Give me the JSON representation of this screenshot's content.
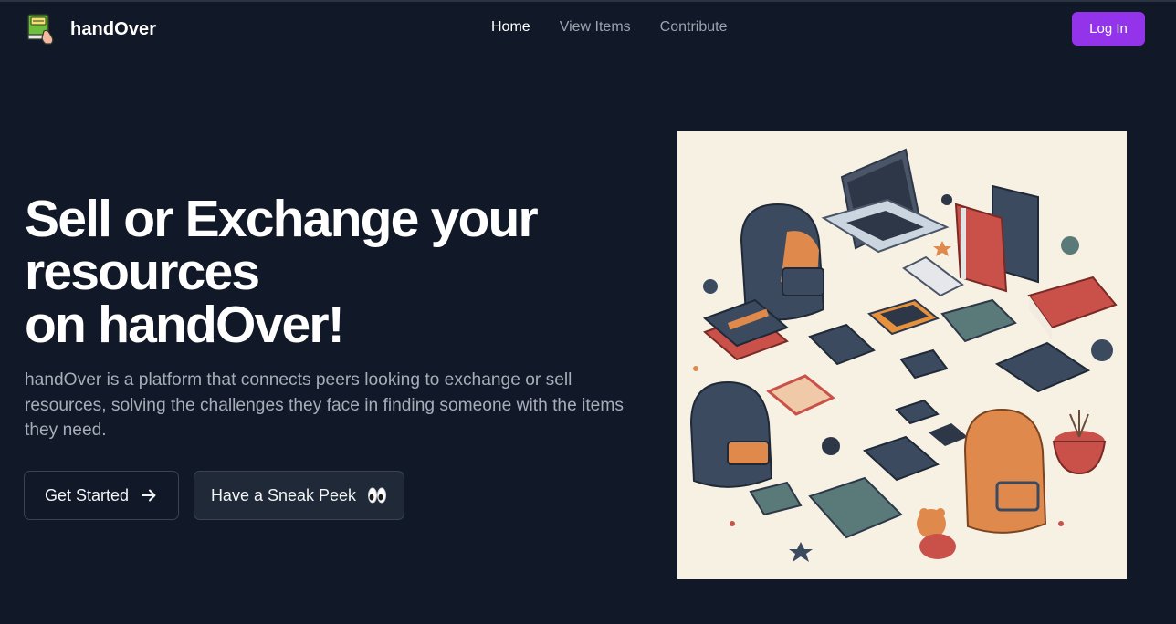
{
  "brand": {
    "name": "handOver",
    "logo_icon": "book-hand-logo-icon"
  },
  "nav": {
    "items": [
      {
        "label": "Home",
        "active": true
      },
      {
        "label": "View Items",
        "active": false
      },
      {
        "label": "Contribute",
        "active": false
      }
    ]
  },
  "auth": {
    "login_label": "Log In"
  },
  "hero": {
    "title_lines": [
      "Sell or Exchange your",
      "resources",
      "on handOver!"
    ],
    "description": "handOver is a platform that connects peers looking to exchange or sell resources, solving the challenges they face in finding someone with the items they need.",
    "primary_cta": {
      "label": "Get Started",
      "icon": "arrow-right-icon"
    },
    "secondary_cta": {
      "label": "Have a Sneak Peek",
      "icon": "eyes-icon"
    },
    "image_alt_icon": "study-supplies-illustration"
  },
  "colors": {
    "background": "#111827",
    "accent": "#9333ea",
    "muted_text": "#9ca3af",
    "illustration_bg": "#f7f1e4"
  }
}
